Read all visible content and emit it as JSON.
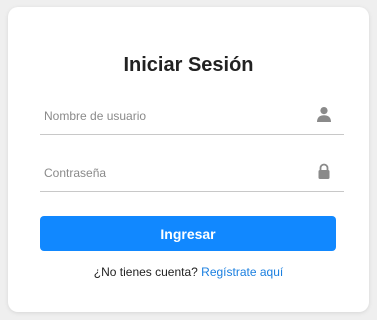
{
  "form": {
    "title": "Iniciar Sesión",
    "username": {
      "value": "",
      "placeholder": "Nombre de usuario",
      "icon": "user-icon"
    },
    "password": {
      "value": "",
      "placeholder": "Contraseña",
      "icon": "lock-icon"
    },
    "submit_label": "Ingresar",
    "register_prompt": "¿No tienes cuenta?",
    "register_link": "Regístrate aquí"
  },
  "colors": {
    "accent": "#1188ff",
    "link": "#1a7fe0",
    "background": "#efefef",
    "card": "#ffffff"
  }
}
